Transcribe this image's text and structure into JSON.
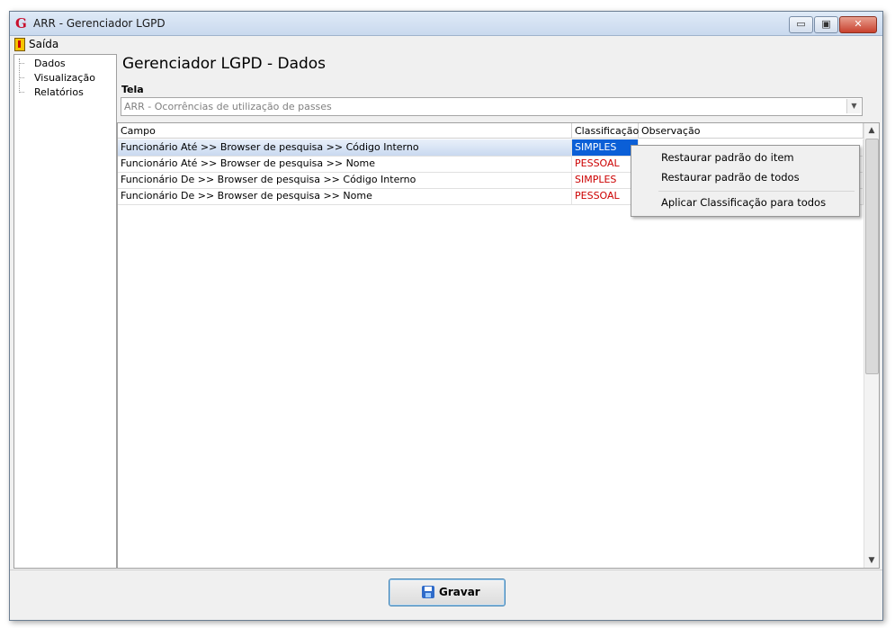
{
  "window": {
    "title": "ARR - Gerenciador LGPD",
    "app_icon_letter": "G",
    "controls": {
      "minimize": "▭",
      "maximize": "▣",
      "close": "✕"
    }
  },
  "menu": {
    "exit_label": "Saída"
  },
  "nav": {
    "items": [
      {
        "label": "Dados"
      },
      {
        "label": "Visualização"
      },
      {
        "label": "Relatórios"
      }
    ]
  },
  "main": {
    "title": "Gerenciador LGPD - Dados",
    "tela_label": "Tela",
    "tela_value": "ARR - Ocorrências de utilização de passes"
  },
  "grid": {
    "columns": [
      "Campo",
      "Classificação",
      "Observação"
    ],
    "rows": [
      {
        "campo": "Funcionário Até >> Browser de pesquisa >> Código Interno",
        "classificacao": "SIMPLES",
        "observacao": "",
        "selected": true
      },
      {
        "campo": "Funcionário Até >> Browser de pesquisa >> Nome",
        "classificacao": "PESSOAL",
        "observacao": ""
      },
      {
        "campo": "Funcionário De >> Browser de pesquisa >> Código Interno",
        "classificacao": "SIMPLES",
        "observacao": ""
      },
      {
        "campo": "Funcionário De >> Browser de pesquisa >> Nome",
        "classificacao": "PESSOAL",
        "observacao": ""
      }
    ]
  },
  "context_menu": {
    "items": [
      "Restaurar padrão do item",
      "Restaurar padrão de todos",
      "Aplicar Classificação para todos"
    ]
  },
  "footer": {
    "save_label": "Gravar"
  },
  "colors": {
    "classification_text": "#cc0000",
    "selected_cell": "#0b5fd7"
  }
}
